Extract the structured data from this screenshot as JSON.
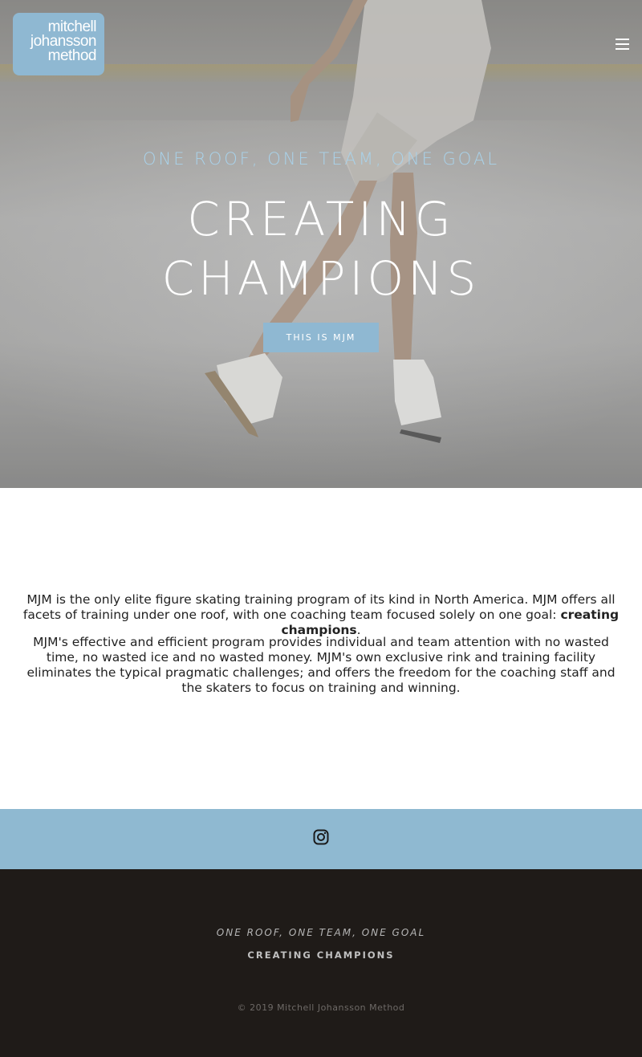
{
  "header": {
    "logo_lines": [
      "mitchell",
      "johansson",
      "method"
    ],
    "menu_icon": "hamburger-menu-icon"
  },
  "hero": {
    "tagline": "ONE ROOF, ONE TEAM, ONE GOAL",
    "headline_line1": "CREATING",
    "headline_line2": "CHAMPIONS",
    "cta_label": "THIS IS MJM"
  },
  "about": {
    "p1_text": "MJM is the only elite figure skating training program of its kind in North America. MJM offers all facets of training under one roof, with one coaching team focused solely on one goal: ",
    "p1_bold": "creating champions",
    "p1_end": ".",
    "p2_text": "MJM's effective and efficient program provides individual and team attention with no wasted time, no wasted ice and no wasted money. MJM's own exclusive rink and training facility eliminates the typical pragmatic challenges; and offers the freedom for the coaching staff and the skaters to focus on training and winning."
  },
  "social": {
    "icon": "instagram-icon"
  },
  "footer": {
    "tagline": "ONE ROOF, ONE TEAM, ONE GOAL",
    "heading": "CREATING CHAMPIONS",
    "copyright": "© 2019 Mitchell Johansson Method"
  },
  "colors": {
    "accent": "#8fb8d2",
    "tagline": "#a9d2ea",
    "footer_bg": "#1f1b18",
    "text": "#222222"
  }
}
